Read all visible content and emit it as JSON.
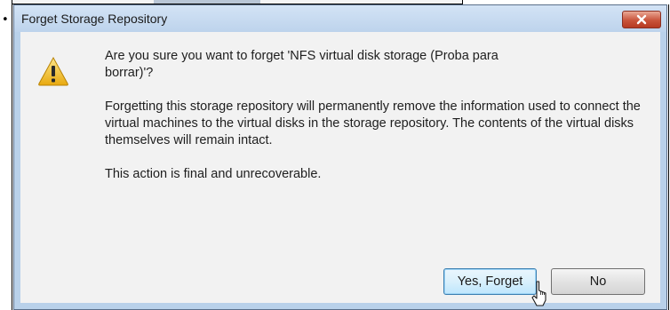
{
  "dialog": {
    "title": "Forget Storage Repository",
    "question": "Are you sure you want to forget 'NFS virtual disk storage (Proba para borrar)'?",
    "details": "Forgetting this storage repository will permanently remove the information used to connect the virtual machines to the virtual disks in the storage repository. The contents of the virtual disks themselves will remain intact.",
    "final_note": "This action is final and unrecoverable.",
    "buttons": {
      "yes": "Yes, Forget",
      "no": "No"
    },
    "icons": {
      "close": "close-icon",
      "warning": "warning-icon",
      "cursor": "mouse-pointer-icon"
    }
  },
  "colors": {
    "frame": "#b9d1ea",
    "close": "#c9543b",
    "warning": "#f2c12e"
  }
}
